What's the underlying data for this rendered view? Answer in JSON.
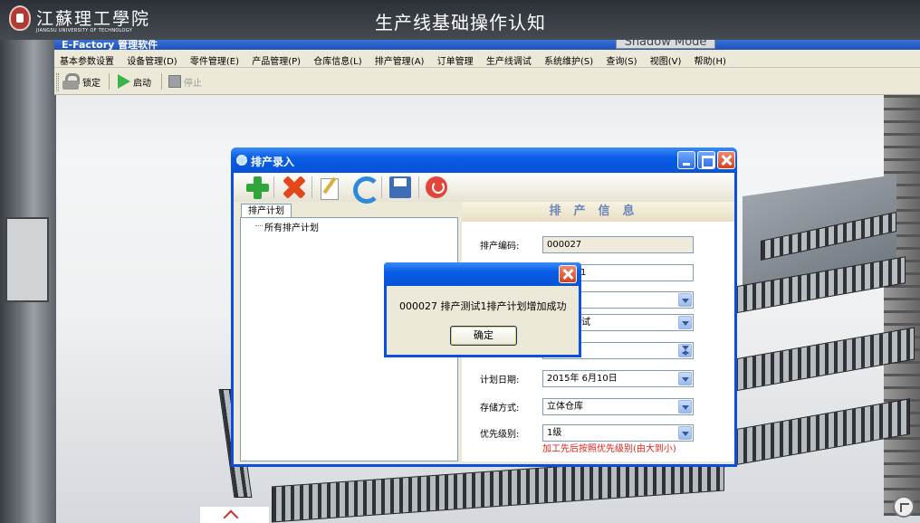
{
  "header": {
    "school_name": "江蘇理工學院",
    "school_name_en": "JIANGSU UNIVERSITY OF TECHNOLOGY",
    "course_title": "生产线基础操作认知"
  },
  "app": {
    "title": "E-Factory 管理软件",
    "shadow_mode": "Shadow Mode",
    "menu": [
      "基本参数设置",
      "设备管理(D)",
      "零件管理(E)",
      "产品管理(P)",
      "仓库信息(L)",
      "排产管理(A)",
      "订单管理",
      "生产线调试",
      "系统维护(S)",
      "查询(S)",
      "视图(V)",
      "帮助(H)"
    ],
    "toolbar": {
      "lock": "锁定",
      "start": "启动",
      "stop": "停止"
    }
  },
  "dialog": {
    "title": "排产录入",
    "tab": "排产计划",
    "tree_root": "所有排产计划",
    "section_title": "排产信息",
    "fields": {
      "code_label": "排产编码:",
      "code_value": "000027",
      "name_value_partial": "1",
      "line_value_partial": "测试",
      "plan_date_label": "计划日期:",
      "plan_date_value": "2015年 6月10日",
      "storage_label": "存储方式:",
      "storage_value": "立体仓库",
      "priority_label": "优先级别:",
      "priority_value": "1级"
    },
    "priority_note": "加工先后按照优先级别(由大到小)"
  },
  "message_box": {
    "text": "000027 排产测试1排产计划增加成功",
    "ok": "确定"
  },
  "colors": {
    "xp_blue": "#0a5de6",
    "dialog_face": "#ece9d8",
    "note_red": "#e0201a",
    "section_title": "#6d86b8"
  }
}
